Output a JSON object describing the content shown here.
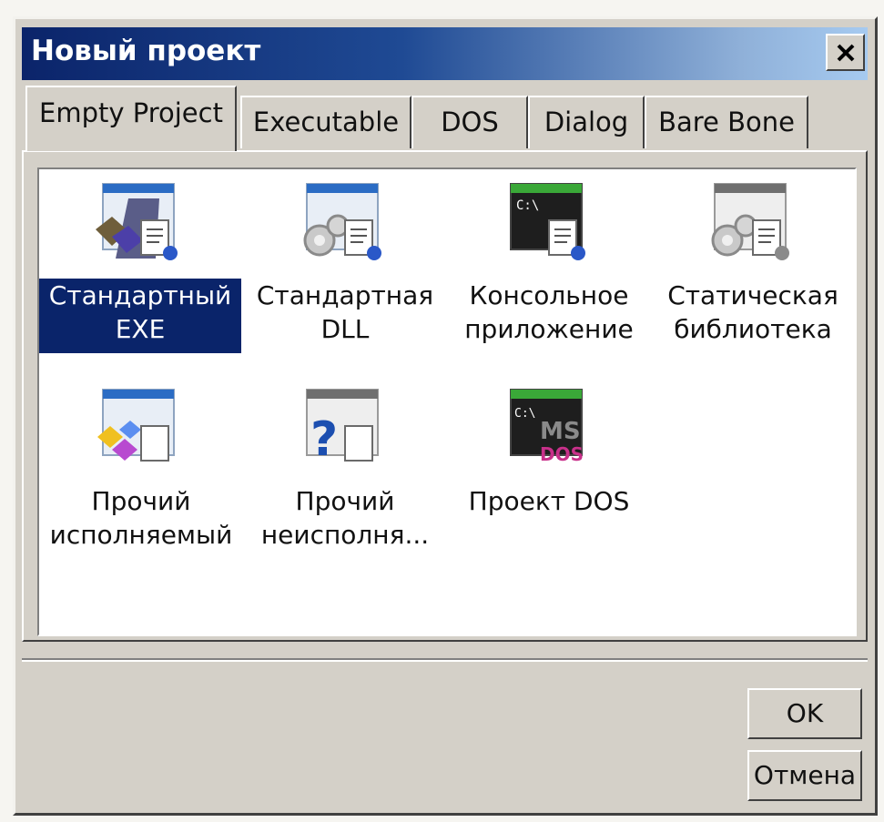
{
  "window": {
    "title": "Новый проект"
  },
  "tabs": [
    {
      "label": "Empty Project",
      "active": true
    },
    {
      "label": "Executable",
      "active": false
    },
    {
      "label": "DOS",
      "active": false
    },
    {
      "label": "Dialog",
      "active": false
    },
    {
      "label": "Bare Bone",
      "active": false
    }
  ],
  "projects": [
    {
      "line1": "Стандартный",
      "line2": "EXE",
      "icon": "standard-exe-icon",
      "selected": true
    },
    {
      "line1": "Стандартная",
      "line2": "DLL",
      "icon": "standard-dll-icon",
      "selected": false
    },
    {
      "line1": "Консольное",
      "line2": "приложение",
      "icon": "console-app-icon",
      "selected": false
    },
    {
      "line1": "Статическая",
      "line2": "библиотека",
      "icon": "static-library-icon",
      "selected": false
    },
    {
      "line1": "Прочий",
      "line2": "исполняемый",
      "icon": "other-executable-icon",
      "selected": false
    },
    {
      "line1": "Прочий",
      "line2": "неисполня...",
      "icon": "other-non-executable-icon",
      "selected": false
    },
    {
      "line1": "Проект DOS",
      "line2": "",
      "icon": "dos-project-icon",
      "selected": false
    }
  ],
  "buttons": {
    "ok": "OK",
    "cancel": "Отмена"
  },
  "icon_text": {
    "console": "C:\\",
    "ms": "MS",
    "dos": "DOS",
    "question": "?"
  },
  "colors": {
    "selection": "#0a246a",
    "titlebar_start": "#0b246a",
    "titlebar_end": "#a6caf0",
    "dialog_face": "#d4d0c8"
  }
}
